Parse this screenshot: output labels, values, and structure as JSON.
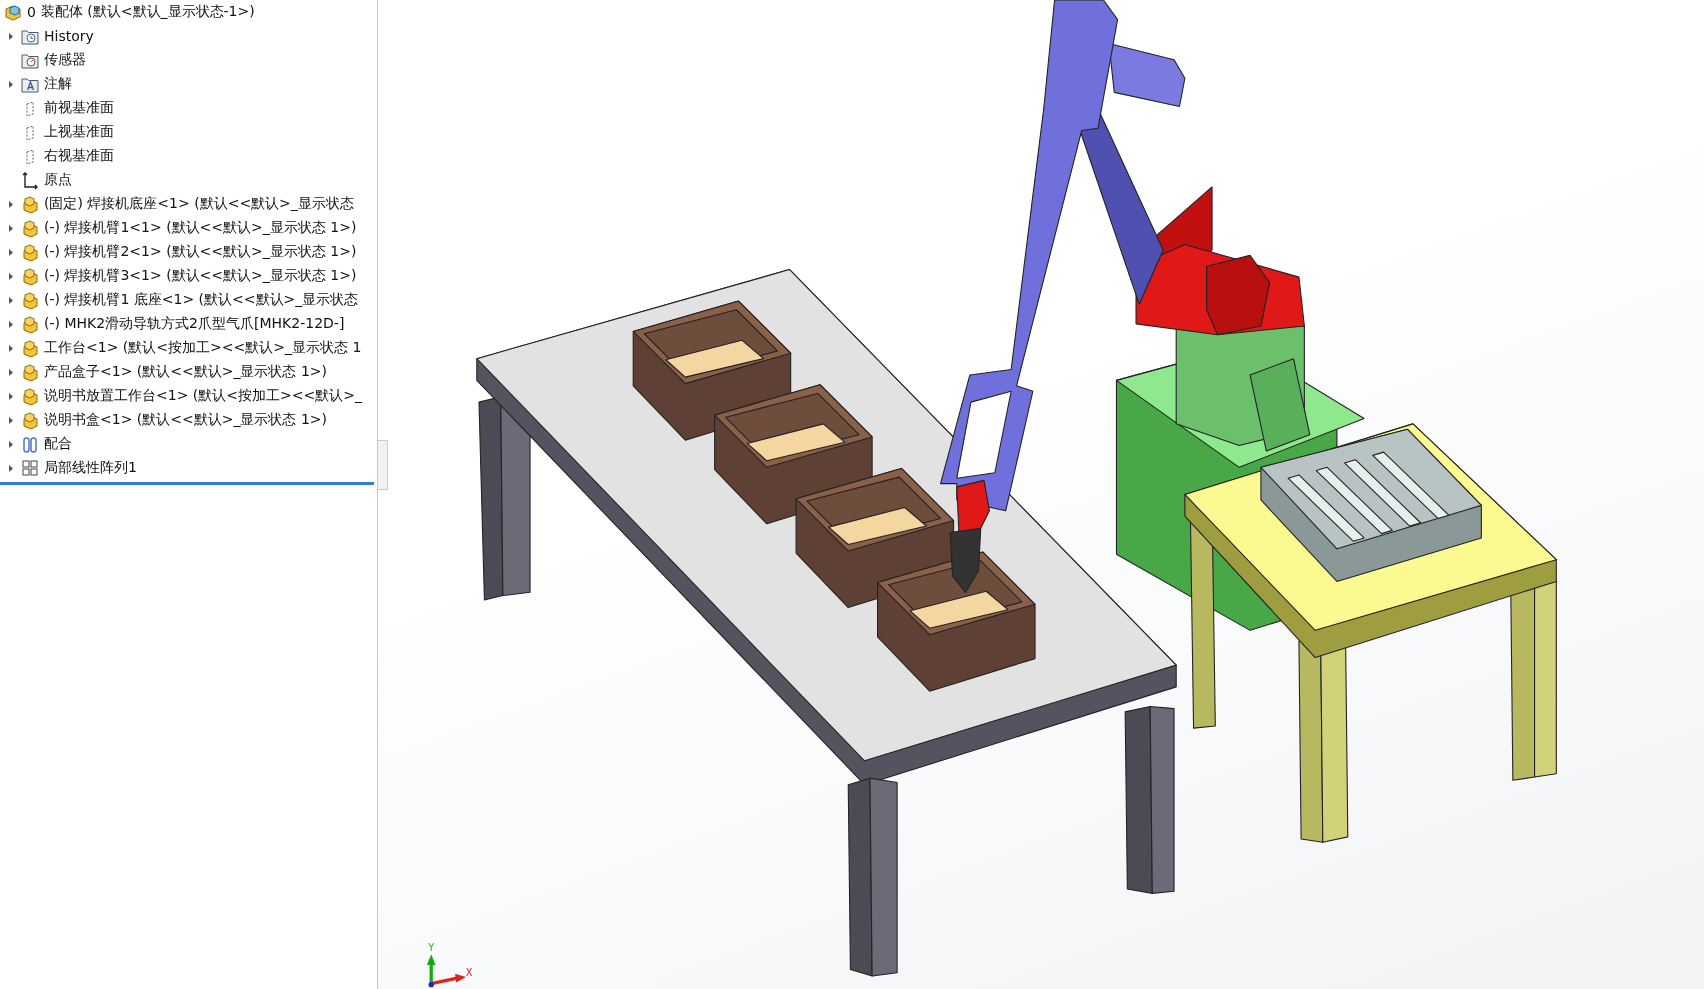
{
  "tree": {
    "root": {
      "number": "0",
      "label": "装配体  (默认<默认_显示状态-1>)"
    },
    "items": [
      {
        "kind": "history",
        "label": "History",
        "expandable": true
      },
      {
        "kind": "sensor",
        "label": "传感器",
        "expandable": false
      },
      {
        "kind": "annotation",
        "label": "注解",
        "expandable": true
      },
      {
        "kind": "plane",
        "label": "前视基准面",
        "expandable": false
      },
      {
        "kind": "plane",
        "label": "上视基准面",
        "expandable": false
      },
      {
        "kind": "plane",
        "label": "右视基准面",
        "expandable": false
      },
      {
        "kind": "origin",
        "label": "原点",
        "expandable": false
      },
      {
        "kind": "part",
        "label": "(固定) 焊接机底座<1> (默认<<默认>_显示状态",
        "expandable": true
      },
      {
        "kind": "part",
        "label": "(-) 焊接机臂1<1> (默认<<默认>_显示状态 1>)",
        "expandable": true
      },
      {
        "kind": "part",
        "label": "(-) 焊接机臂2<1> (默认<<默认>_显示状态 1>)",
        "expandable": true
      },
      {
        "kind": "part",
        "label": "(-) 焊接机臂3<1> (默认<<默认>_显示状态 1>)",
        "expandable": true
      },
      {
        "kind": "part",
        "label": "(-) 焊接机臂1 底座<1> (默认<<默认>_显示状态",
        "expandable": true
      },
      {
        "kind": "part",
        "label": "(-) MHK2滑动导轨方式2爪型气爪[MHK2-12D-]",
        "expandable": true
      },
      {
        "kind": "part",
        "label": "工作台<1> (默认<按加工><<默认>_显示状态 1",
        "expandable": true
      },
      {
        "kind": "part",
        "label": "产品盒子<1> (默认<<默认>_显示状态 1>)",
        "expandable": true
      },
      {
        "kind": "part",
        "label": "说明书放置工作台<1> (默认<按加工><<默认>_",
        "expandable": true
      },
      {
        "kind": "part",
        "label": "说明书盒<1> (默认<<默认>_显示状态 1>)",
        "expandable": true
      },
      {
        "kind": "mates",
        "label": "配合",
        "expandable": true
      },
      {
        "kind": "pattern",
        "label": "局部线性阵列1",
        "expandable": true
      }
    ]
  },
  "triad": {
    "y_label": "Y",
    "x_label": "X"
  }
}
